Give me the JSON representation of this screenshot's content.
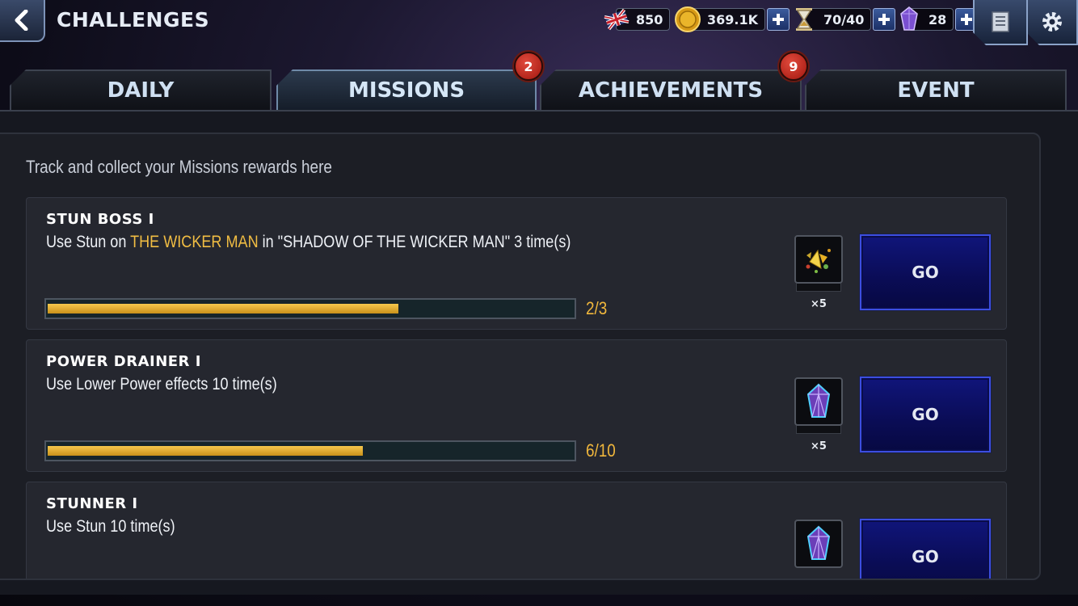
{
  "header": {
    "title": "CHALLENGES",
    "back_icon": "chevron-left-icon",
    "currencies": [
      {
        "name": "units",
        "icon": "union-jack-icon",
        "value": "850",
        "has_plus": false
      },
      {
        "name": "gold",
        "icon": "gold-coin-icon",
        "value": "369.1K",
        "has_plus": true
      },
      {
        "name": "energy",
        "icon": "hourglass-icon",
        "value": "70/40",
        "has_plus": true
      },
      {
        "name": "crystals",
        "icon": "crystal-icon",
        "value": "28",
        "has_plus": true
      }
    ],
    "buttons": [
      "scroll-icon",
      "gear-icon"
    ]
  },
  "tabs": [
    {
      "label": "DAILY",
      "active": false,
      "badge": ""
    },
    {
      "label": "MISSIONS",
      "active": true,
      "badge": "2"
    },
    {
      "label": "ACHIEVEMENTS",
      "active": false,
      "badge": "9"
    },
    {
      "label": "EVENT",
      "active": false,
      "badge": ""
    }
  ],
  "main": {
    "subtitle": "Track and collect your Missions rewards here",
    "missions": [
      {
        "title": "STUN BOSS I",
        "desc_prefix": "Use Stun on ",
        "desc_highlight": "THE WICKER MAN",
        "desc_suffix": " in \"SHADOW OF THE WICKER MAN\" 3 time(s)",
        "progress_text": "2/3",
        "progress_fraction": 0.667,
        "reward_icon": "gold-fragments-icon",
        "reward_qty": "×5",
        "button": "GO"
      },
      {
        "title": "POWER DRAINER I",
        "desc_prefix": "Use Lower Power effects 10 time(s)",
        "desc_highlight": "",
        "desc_suffix": "",
        "progress_text": "6/10",
        "progress_fraction": 0.6,
        "reward_icon": "crystal-icon",
        "reward_qty": "×5",
        "button": "GO"
      },
      {
        "title": "STUNNER I",
        "desc_prefix": "Use Stun 10 time(s)",
        "desc_highlight": "",
        "desc_suffix": "",
        "reward_icon": "crystal-icon",
        "button": "GO"
      }
    ]
  },
  "colors": {
    "highlight": "#f1bd43",
    "progress": "#e7b13a",
    "go_button": "#0c0f6a",
    "badge": "#c8261a"
  }
}
